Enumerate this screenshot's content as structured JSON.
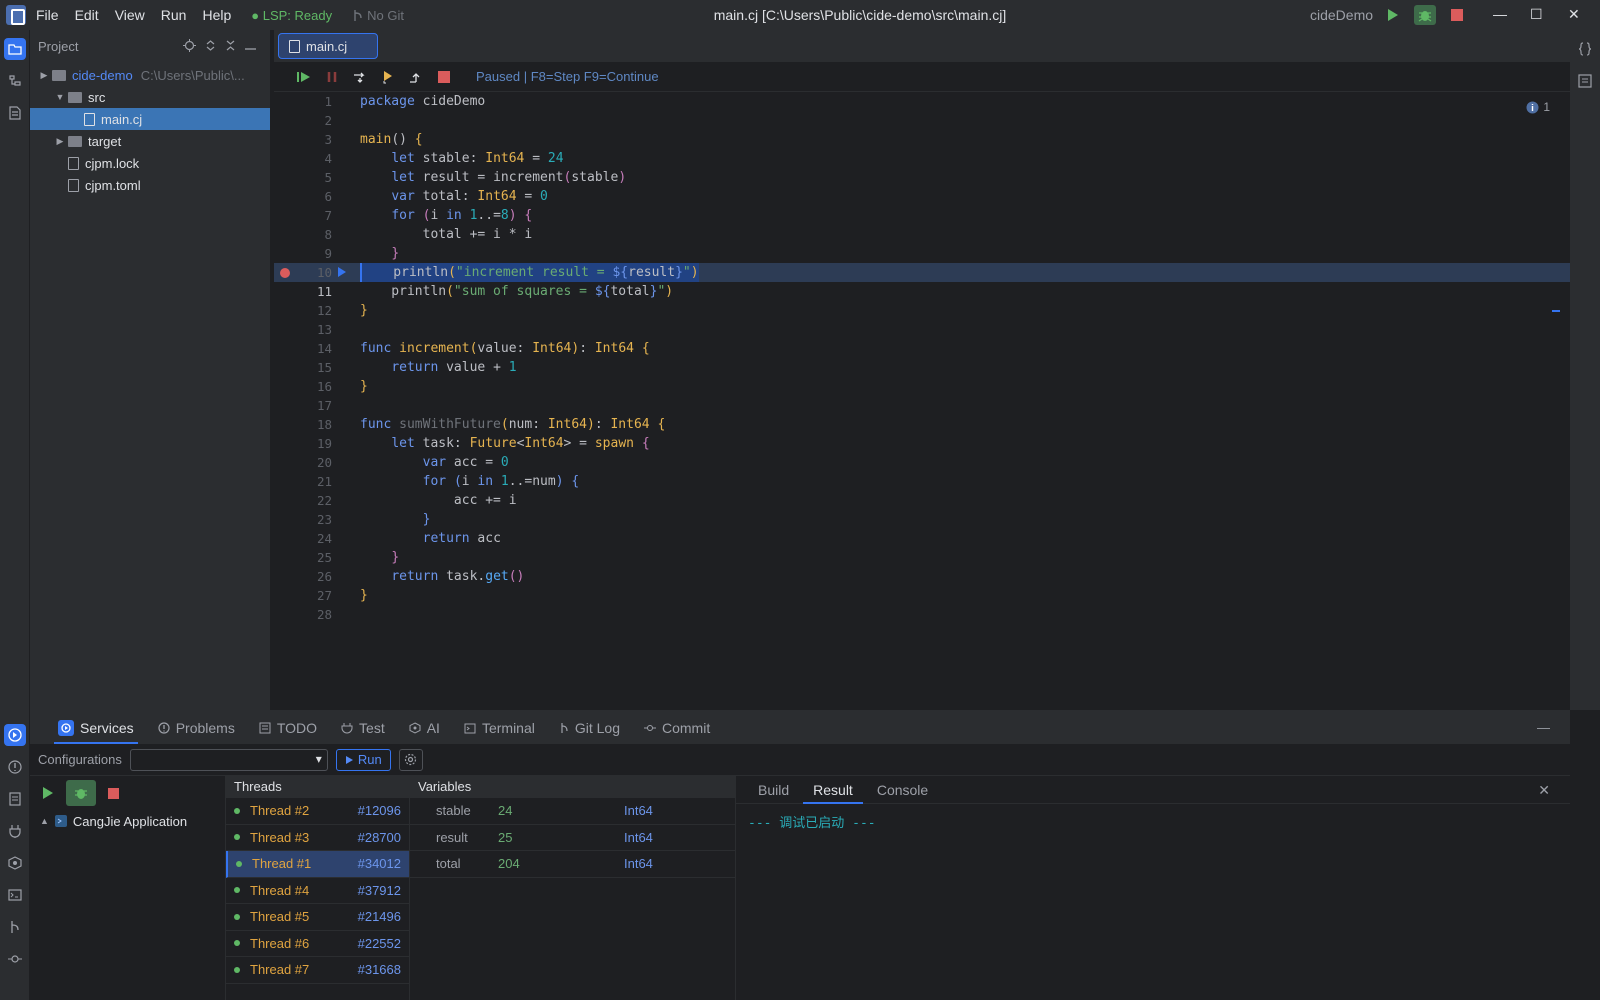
{
  "menu": [
    "File",
    "Edit",
    "View",
    "Run",
    "Help"
  ],
  "status": {
    "lsp": "LSP: Ready",
    "git": "No Git"
  },
  "window_title": "main.cj [C:\\Users\\Public\\cide-demo\\src\\main.cj]",
  "project_name": "cideDemo",
  "colors": {
    "accent": "#3574f0",
    "run": "#5fb865",
    "stop": "#db5c5c",
    "bg": "#1e1f22",
    "panel": "#2b2d30"
  },
  "project_panel": {
    "title": "Project",
    "tree": [
      {
        "label": "cide-demo",
        "hint": "C:\\Users\\Public\\...",
        "depth": 0,
        "type": "folder",
        "open": false
      },
      {
        "label": "src",
        "depth": 1,
        "type": "folder",
        "open": true
      },
      {
        "label": "main.cj",
        "depth": 2,
        "type": "file",
        "selected": true
      },
      {
        "label": "target",
        "depth": 1,
        "type": "folder",
        "open": false
      },
      {
        "label": "cjpm.lock",
        "depth": 1,
        "type": "file"
      },
      {
        "label": "cjpm.toml",
        "depth": 1,
        "type": "file"
      }
    ]
  },
  "editor": {
    "tab": "main.cj",
    "debug_status": "Paused | F8=Step F9=Continue",
    "problems_count": "1",
    "breakpoint_line": 10,
    "current_line": 11
  },
  "bottom_tabs": [
    "Services",
    "Problems",
    "TODO",
    "Test",
    "AI",
    "Terminal",
    "Git Log",
    "Commit"
  ],
  "services": {
    "config_label": "Configurations",
    "run_label": "Run",
    "app_label": "CangJie Application",
    "threads_title": "Threads",
    "threads": [
      {
        "name": "Thread #2",
        "id": "#12096"
      },
      {
        "name": "Thread #3",
        "id": "#28700"
      },
      {
        "name": "Thread #1",
        "id": "#34012",
        "selected": true
      },
      {
        "name": "Thread #4",
        "id": "#37912"
      },
      {
        "name": "Thread #5",
        "id": "#21496"
      },
      {
        "name": "Thread #6",
        "id": "#22552"
      },
      {
        "name": "Thread #7",
        "id": "#31668"
      }
    ],
    "vars_title": "Variables",
    "variables": [
      {
        "name": "stable",
        "value": "24",
        "type": "Int64"
      },
      {
        "name": "result",
        "value": "25",
        "type": "Int64"
      },
      {
        "name": "total",
        "value": "204",
        "type": "Int64"
      }
    ],
    "output_tabs": [
      "Build",
      "Result",
      "Console"
    ],
    "output_active": "Result",
    "output_text": "--- 调试已启动 ---"
  }
}
